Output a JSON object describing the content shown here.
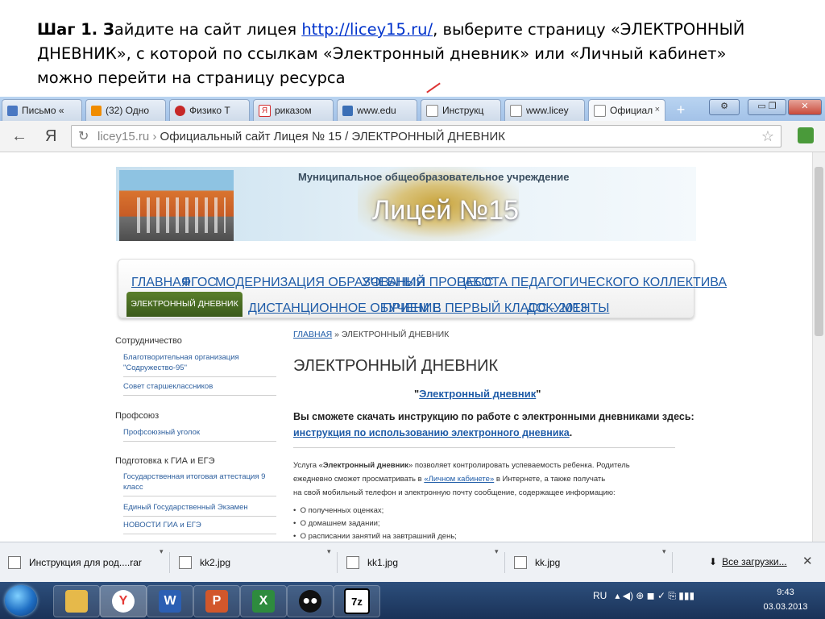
{
  "caption": {
    "step_label": "Шаг 1. З",
    "text_1": "айдите на сайт лицея ",
    "url": "http://licey15.ru/",
    "text_2": ", выберите  страницу «ЭЛЕКТРОННЫЙ",
    "line_2": "ДНЕВНИК», с которой по ссылкам  «Электронный дневник» или «Личный кабинет»",
    "line_3": "можно перейти на страницу ресурса"
  },
  "browser": {
    "tabs": [
      {
        "label": "Письмо «",
        "color": "#4a78c2"
      },
      {
        "label": "(32) Одно",
        "color": "#f08c00"
      },
      {
        "label": "Физико Т",
        "color": "#c62828"
      },
      {
        "label": "рикaзом",
        "color": "#d32f2f"
      },
      {
        "label": "www.edu",
        "color": "#3b6fb6"
      },
      {
        "label": "Инструкц",
        "color": "#ffffff"
      },
      {
        "label": "www.licey",
        "color": "#ffffff"
      },
      {
        "label": "Официал",
        "color": "#ffffff"
      }
    ],
    "tab_close": "×",
    "new_tab": "+",
    "back": "←",
    "yandex_logo": "Я",
    "reload": "↻",
    "url_domain": "licey15.ru",
    "url_sep": " › ",
    "url_title": "Официальный сайт Лицея № 15 / ЭЛЕКТРОННЫЙ ДНЕВНИК",
    "star": "☆"
  },
  "site": {
    "org_name": "Муниципальное общеобразовательное учреждение",
    "site_name": "Лицей №15",
    "nav_row1": [
      "ГЛАВНАЯ",
      "ФГОС",
      "МОДЕРНИЗАЦИЯ ОБРАЗОВАНИЯ",
      "УЧЕБНЫЙ ПРОЦЕСС",
      "РАБОТА ПЕДАГОГИЧЕСКОГО КОЛЛЕКТИВА"
    ],
    "nav_active": "ЭЛЕКТРОННЫЙ ДНЕВНИК",
    "nav_row2": [
      "ДИСТАНЦИОННОЕ ОБУЧЕНИЕ",
      "ПРИЕМ В ПЕРВЫЙ КЛАСС - 2013",
      "ДОКУМЕНТЫ"
    ],
    "sidebar": {
      "sections": [
        {
          "head": "Сотрудничество",
          "items": [
            "Благотворительная организация \"Содружество-95\"",
            "Совет старшеклассников"
          ]
        },
        {
          "head": "Профсоюз",
          "items": [
            "Профсоюзный уголок"
          ]
        },
        {
          "head": "Подготовка к ГИА и ЕГЭ",
          "items": [
            "Государственная итоговая аттестация 9 класс",
            "Единый Государственный Экзамен",
            "НОВОСТИ ГИА и ЕГЭ"
          ]
        }
      ]
    },
    "main": {
      "crumb_home": "ГЛАВНАЯ",
      "crumb_current": " » ЭЛЕКТРОННЫЙ ДНЕВНИК",
      "title": "ЭЛЕКТРОННЫЙ ДНЕВНИК",
      "ediary_quote_open": "\"",
      "ediary_link": "Электронный  дневник",
      "ediary_quote_close": "\"",
      "download_text": "Вы сможете скачать инструкцию по работе с электронными дневниками здесь:",
      "download_link": "инструкция по использованию электронного дневника",
      "download_dot": ".",
      "para_1a": "Услуга «",
      "para_1b": "Электронный дневник",
      "para_1c": "» позволяет контролировать успеваемость ребенка. Родитель",
      "para_2a": "ежедневно сможет просматривать в ",
      "para_2b": "«Личном кабинете»",
      "para_2c": " в Интернете, а также получать",
      "para_3": "на свой мобильный телефон и электронную почту сообщение, содержащее информацию:",
      "bullets": [
        "О полученных оценках;",
        "О домашнем задании;",
        "О расписании занятий на завтрашний день;"
      ]
    }
  },
  "downloads": {
    "items": [
      "Инструкция для род....rar",
      "kk2.jpg",
      "kk1.jpg",
      "kk.jpg"
    ],
    "menu_arrow": "▾",
    "all_downloads": "Все загрузки...",
    "close": "✕"
  },
  "taskbar": {
    "lang": "RU",
    "time": "9:43",
    "date": "03.03.2013"
  }
}
